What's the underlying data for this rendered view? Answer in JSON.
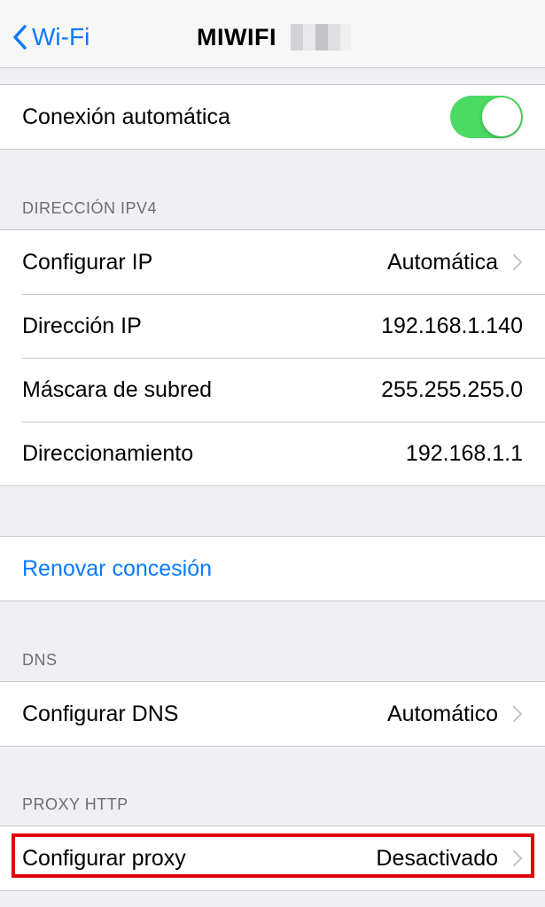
{
  "navbar": {
    "back_label": "Wi-Fi",
    "title": "MIWIFI"
  },
  "auto_join": {
    "label": "Conexión automática",
    "enabled": true
  },
  "ipv4": {
    "header": "DIRECCIÓN IPV4",
    "rows": [
      {
        "label": "Configurar IP",
        "value": "Automática"
      },
      {
        "label": "Dirección IP",
        "value": "192.168.1.140"
      },
      {
        "label": "Máscara de subred",
        "value": "255.255.255.0"
      },
      {
        "label": "Direccionamiento",
        "value": "192.168.1.1"
      }
    ]
  },
  "renew": {
    "label": "Renovar concesión"
  },
  "dns": {
    "header": "DNS",
    "label": "Configurar DNS",
    "value": "Automático"
  },
  "proxy": {
    "header": "PROXY HTTP",
    "label": "Configurar proxy",
    "value": "Desactivado"
  },
  "colors": {
    "accent": "#0a7aff",
    "toggle_on": "#4cd964",
    "highlight": "#e0000b",
    "background": "#efeff4"
  }
}
